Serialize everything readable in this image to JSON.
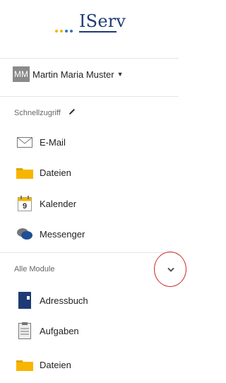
{
  "brand": {
    "logo_text": "IServ",
    "accent": "#1f3b75",
    "dot_colors": [
      "#f2b400",
      "#f2b400",
      "#2f74c0",
      "#2f74c0"
    ]
  },
  "user": {
    "initials": "MM",
    "name": "Martin Maria Muster",
    "caret_icon": "caret-down-icon"
  },
  "quick_access": {
    "title": "Schnellzugriff",
    "edit_icon": "pencil-icon",
    "items": [
      {
        "label": "E-Mail",
        "icon": "envelope-icon"
      },
      {
        "label": "Dateien",
        "icon": "folder-icon"
      },
      {
        "label": "Kalender",
        "icon": "calendar-icon",
        "calendar_day": "9"
      },
      {
        "label": "Messenger",
        "icon": "chat-bubbles-icon"
      }
    ]
  },
  "all_modules": {
    "title": "Alle Module",
    "toggle_icon": "chevron-down-icon",
    "items": [
      {
        "label": "Adressbuch",
        "icon": "address-book-icon"
      },
      {
        "label": "Aufgaben",
        "icon": "clipboard-icon"
      },
      {
        "label": "Dateien",
        "icon": "folder-icon"
      }
    ]
  },
  "annotation": {
    "color": "#d0302c"
  }
}
